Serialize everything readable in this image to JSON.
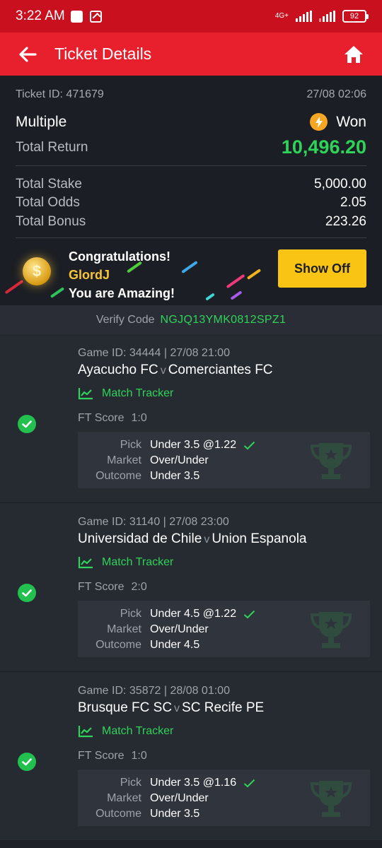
{
  "status_bar": {
    "time": "3:22 AM",
    "network": "4G+",
    "battery": "92"
  },
  "app_bar": {
    "title": "Ticket Details"
  },
  "ticket": {
    "id_label": "Ticket ID: 471679",
    "datetime": "27/08 02:06",
    "type": "Multiple",
    "status": "Won",
    "return_label": "Total Return",
    "return_value": "10,496.20",
    "stake_label": "Total Stake",
    "stake_value": "5,000.00",
    "odds_label": "Total Odds",
    "odds_value": "2.05",
    "bonus_label": "Total Bonus",
    "bonus_value": "223.26"
  },
  "banner": {
    "line1": "Congratulations!",
    "user": "GlordJ",
    "line3": "You are Amazing!",
    "button": "Show Off"
  },
  "verify": {
    "label": "Verify Code",
    "code": "NGJQ13YMK0812SPZ1"
  },
  "matches": [
    {
      "meta": "Game ID: 34444 | 27/08 21:00",
      "home": "Ayacucho FC",
      "vs": "v",
      "away": "Comerciantes FC",
      "tracker": "Match Tracker",
      "ft_label": "FT Score",
      "ft_score": "1:0",
      "pick_label": "Pick",
      "pick": "Under 3.5 @1.22",
      "market_label": "Market",
      "market": "Over/Under",
      "outcome_label": "Outcome",
      "outcome": "Under 3.5"
    },
    {
      "meta": "Game ID: 31140 | 27/08 23:00",
      "home": "Universidad de Chile",
      "vs": "v",
      "away": "Union Espanola",
      "tracker": "Match Tracker",
      "ft_label": "FT Score",
      "ft_score": "2:0",
      "pick_label": "Pick",
      "pick": "Under 4.5 @1.22",
      "market_label": "Market",
      "market": "Over/Under",
      "outcome_label": "Outcome",
      "outcome": "Under 4.5"
    },
    {
      "meta": "Game ID: 35872 | 28/08 01:00",
      "home": "Brusque FC SC",
      "vs": "v",
      "away": "SC Recife PE",
      "tracker": "Match Tracker",
      "ft_label": "FT Score",
      "ft_score": "1:0",
      "pick_label": "Pick",
      "pick": "Under 3.5 @1.16",
      "market_label": "Market",
      "market": "Over/Under",
      "outcome_label": "Outcome",
      "outcome": "Under 3.5"
    }
  ],
  "colors": {
    "brand_red": "#e8202d",
    "win_green": "#2fd35a",
    "accent_yellow": "#f9c413"
  }
}
